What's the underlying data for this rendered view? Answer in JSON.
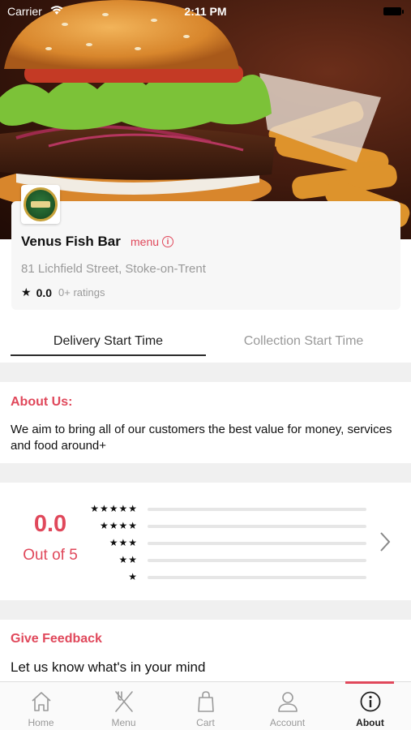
{
  "status_bar": {
    "carrier": "Carrier",
    "time": "2:11 PM"
  },
  "restaurant": {
    "name": "Venus Fish Bar",
    "menu_label": "menu",
    "address": "81 Lichfield Street, Stoke-on-Trent",
    "rating": "0.0",
    "ratings_count": "0+ ratings"
  },
  "tabs": {
    "delivery": "Delivery Start Time",
    "collection": "Collection Start Time"
  },
  "about": {
    "title": "About Us:",
    "text": "We aim to bring all of our customers the best value for money, services and food around+"
  },
  "ratings_summary": {
    "score": "0.0",
    "out_of": "Out of 5",
    "rows": [
      {
        "stars": "★★★★★",
        "fraction": 0
      },
      {
        "stars": "★★★★",
        "fraction": 0
      },
      {
        "stars": "★★★",
        "fraction": 0
      },
      {
        "stars": "★★",
        "fraction": 0
      },
      {
        "stars": "★",
        "fraction": 0
      }
    ]
  },
  "feedback": {
    "title": "Give Feedback",
    "text": "Let us know what's in your mind"
  },
  "tabbar": {
    "items": [
      {
        "label": "Home",
        "icon": "home-icon"
      },
      {
        "label": "Menu",
        "icon": "cutlery-icon"
      },
      {
        "label": "Cart",
        "icon": "shopping-bag-icon"
      },
      {
        "label": "Account",
        "icon": "user-icon"
      },
      {
        "label": "About",
        "icon": "info-icon"
      }
    ],
    "active": "About"
  },
  "colors": {
    "accent": "#e0485b",
    "muted": "#9a9a9a",
    "divider": "#f0f0f0"
  }
}
